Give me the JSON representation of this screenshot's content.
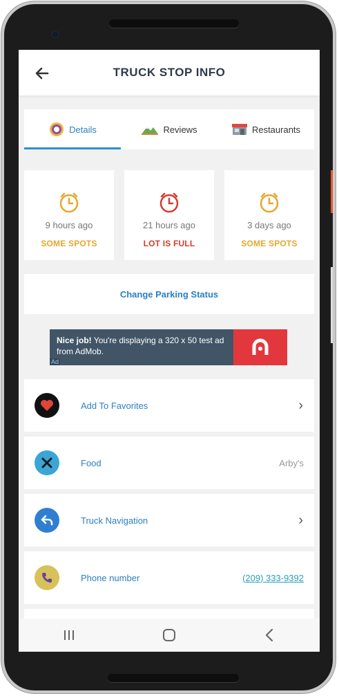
{
  "app": {
    "title": "TRUCK STOP INFO"
  },
  "tabs": [
    {
      "label": "Details",
      "icon": "details-badge-icon",
      "active": true
    },
    {
      "label": "Reviews",
      "icon": "mountain-icon",
      "active": false
    },
    {
      "label": "Restaurants",
      "icon": "restaurant-icon",
      "active": false
    }
  ],
  "status_cards": [
    {
      "time": "9 hours ago",
      "status": "SOME SPOTS",
      "color": "#e7a62b"
    },
    {
      "time": "21 hours ago",
      "status": "LOT IS FULL",
      "color": "#d33c2c"
    },
    {
      "time": "3 days ago",
      "status": "SOME SPOTS",
      "color": "#e7a62b"
    }
  ],
  "change_parking_label": "Change Parking Status",
  "ad": {
    "bold": "Nice job!",
    "text": " You're displaying a 320 x 50 test ad from AdMob.",
    "corner": "Ad"
  },
  "list": [
    {
      "label": "Add To Favorites",
      "icon": "heart-icon",
      "value": "",
      "chevron": true
    },
    {
      "label": "Food",
      "icon": "utensils-icon",
      "value": "Arby's",
      "chevron": false
    },
    {
      "label": "Truck Navigation",
      "icon": "navigation-arrow-icon",
      "value": "",
      "chevron": true
    },
    {
      "label": "Phone number",
      "icon": "phone-icon",
      "value": "(209) 333-9392",
      "chevron": false
    }
  ],
  "colors": {
    "accent": "#2a7fc2",
    "some_spots": "#e7a62b",
    "lot_full": "#d33c2c",
    "ad_bg": "#415566",
    "ad_brand": "#e2383d"
  }
}
